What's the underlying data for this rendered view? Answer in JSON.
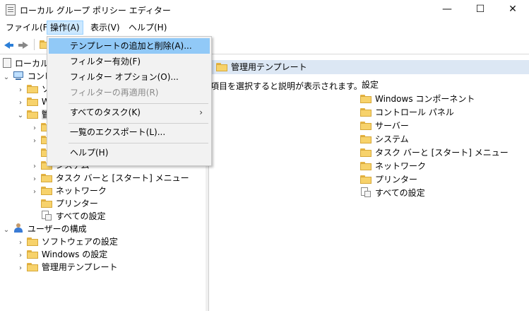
{
  "window": {
    "title": "ローカル グループ ポリシー エディター",
    "minimize": "—",
    "maximize": "☐",
    "close": "✕"
  },
  "menubar": {
    "items": [
      "ファイル(F)",
      "操作(A)",
      "表示(V)",
      "ヘルプ(H)"
    ],
    "active_index": 1
  },
  "dropdown": {
    "items": [
      {
        "label": "テンプレートの追加と削除(A)...",
        "state": "hover"
      },
      {
        "label": "フィルター有効(F)",
        "state": "normal"
      },
      {
        "label": "フィルター オプション(O)...",
        "state": "normal"
      },
      {
        "label": "フィルターの再適用(R)",
        "state": "disabled"
      },
      {
        "label": "すべてのタスク(K)",
        "state": "normal",
        "submenu": "›"
      },
      {
        "label": "一覧のエクスポート(L)...",
        "state": "normal"
      },
      {
        "label": "ヘルプ(H)",
        "state": "normal"
      }
    ]
  },
  "tree": {
    "root": "ローカル",
    "computer": "コンピ",
    "partial_items": [
      "ソ",
      "W",
      "管"
    ],
    "items": {
      "system": "システム",
      "taskbar": "タスク バーと [スタート] メニュー",
      "network": "ネットワーク",
      "printers": "プリンター",
      "all_settings": "すべての設定",
      "user_config": "ユーザーの構成",
      "user_software": "ソフトウェアの設定",
      "user_windows": "Windows の設定",
      "user_admin": "管理用テンプレート"
    },
    "chevrons": {
      "expanded": "⌄",
      "collapsed": "›"
    }
  },
  "right_pane": {
    "header": "管理用テンプレート",
    "description": "項目を選択すると説明が表示されます。",
    "column": "設定",
    "items": [
      {
        "label": "Windows コンポーネント",
        "icon": "folder-icon"
      },
      {
        "label": "コントロール パネル",
        "icon": "folder-icon"
      },
      {
        "label": "サーバー",
        "icon": "folder-icon"
      },
      {
        "label": "システム",
        "icon": "folder-icon"
      },
      {
        "label": "タスク バーと [スタート] メニュー",
        "icon": "folder-icon"
      },
      {
        "label": "ネットワーク",
        "icon": "folder-icon"
      },
      {
        "label": "プリンター",
        "icon": "folder-icon"
      },
      {
        "label": "すべての設定",
        "icon": "settings-doc-icon"
      }
    ]
  }
}
